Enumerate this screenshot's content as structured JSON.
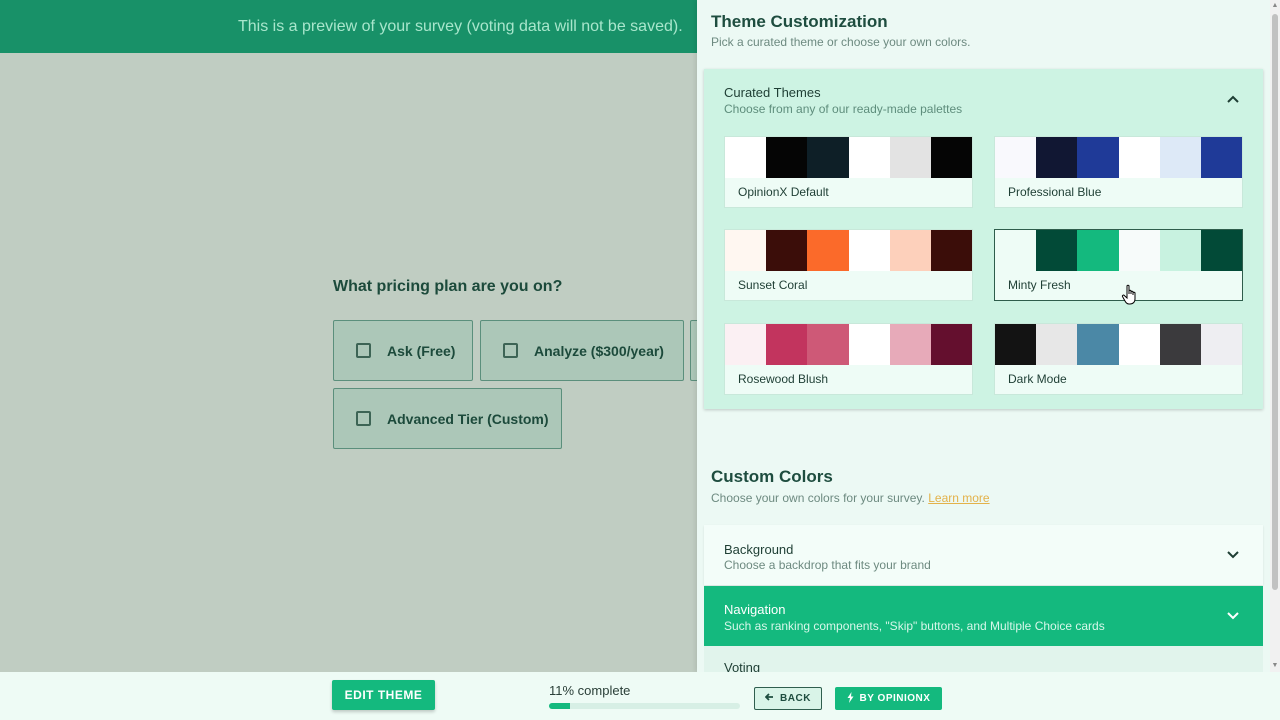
{
  "banner": {
    "text": "This is a preview of your survey (voting data will not be saved)."
  },
  "survey": {
    "question": "What pricing plan are you on?",
    "choices": [
      {
        "label": "Ask (Free)"
      },
      {
        "label": "Analyze ($300/year)"
      },
      {
        "label": ""
      },
      {
        "label": "Advanced Tier (Custom)"
      }
    ]
  },
  "panel": {
    "title": "Theme Customization",
    "subtitle": "Pick a curated theme or choose your own colors.",
    "curated": {
      "title": "Curated Themes",
      "subtitle": "Choose from any of our ready-made palettes",
      "themes": [
        {
          "name": "OpinionX Default",
          "colors": [
            "#ffffff",
            "#050505",
            "#0e1f27",
            "#ffffff",
            "#e3e3e3",
            "#050505"
          ]
        },
        {
          "name": "Professional Blue",
          "colors": [
            "#f9f9fd",
            "#111733",
            "#1f3a98",
            "#ffffff",
            "#dde9f7",
            "#1f3a98"
          ]
        },
        {
          "name": "Sunset Coral",
          "colors": [
            "#fff7f1",
            "#3b0d09",
            "#fb6a2a",
            "#ffffff",
            "#fdd0bb",
            "#3b0d09"
          ]
        },
        {
          "name": "Minty Fresh",
          "colors": [
            "#eefcf6",
            "#024a37",
            "#14b97e",
            "#f7fbfa",
            "#c8f2e0",
            "#024a37"
          ],
          "selected": true
        },
        {
          "name": "Rosewood Blush",
          "colors": [
            "#fbf0f3",
            "#c2345e",
            "#ce5977",
            "#ffffff",
            "#e7aab9",
            "#640f2e"
          ]
        },
        {
          "name": "Dark Mode",
          "colors": [
            "#131313",
            "#e7e7e7",
            "#4b88a6",
            "#ffffff",
            "#3b3a3d",
            "#eeeef2"
          ]
        }
      ]
    },
    "custom": {
      "title": "Custom Colors",
      "subtitle": "Choose your own colors for your survey.",
      "learn_more": "Learn more"
    },
    "sections": {
      "background": {
        "title": "Background",
        "subtitle": "Choose a backdrop that fits your brand"
      },
      "navigation": {
        "title": "Navigation",
        "subtitle": "Such as ranking components, \"Skip\" buttons, and Multiple Choice cards"
      },
      "voting": {
        "title": "Voting"
      }
    }
  },
  "bottom": {
    "edit_theme": "EDIT THEME",
    "progress_text": "11% complete",
    "progress_value": 0.11,
    "back": "BACK",
    "by_opinionx": "BY OPINIONX"
  },
  "colors": {
    "accent": "#14b97e",
    "dark_green": "#024a37",
    "banner": "#189168"
  }
}
